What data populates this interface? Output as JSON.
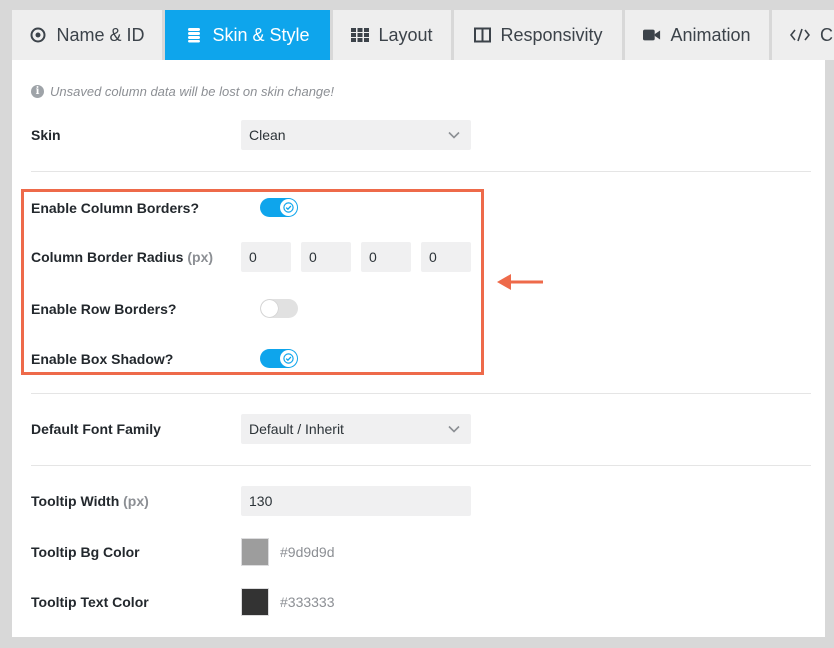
{
  "tabs": [
    {
      "label": "Name & ID",
      "icon": "target-icon",
      "active": false
    },
    {
      "label": "Skin & Style",
      "icon": "layers-icon",
      "active": true
    },
    {
      "label": "Layout",
      "icon": "grid-icon",
      "active": false
    },
    {
      "label": "Responsivity",
      "icon": "columns-icon",
      "active": false
    },
    {
      "label": "Animation",
      "icon": "video-camera-icon",
      "active": false
    },
    {
      "label": "</>",
      "icon": "code-icon",
      "active": false,
      "partial_text": "C"
    }
  ],
  "notice": {
    "text": "Unsaved column data will be lost on skin change!",
    "icon": "info-icon"
  },
  "skin": {
    "label": "Skin",
    "value": "Clean"
  },
  "column_borders": {
    "label": "Enable Column Borders?",
    "enabled": true
  },
  "border_radius": {
    "label": "Column Border Radius",
    "unit": "(px)",
    "values": [
      "0",
      "0",
      "0",
      "0"
    ]
  },
  "row_borders": {
    "label": "Enable Row Borders?",
    "enabled": false
  },
  "box_shadow": {
    "label": "Enable Box Shadow?",
    "enabled": true
  },
  "font_family": {
    "label": "Default Font Family",
    "value": "Default / Inherit"
  },
  "tooltip_width": {
    "label": "Tooltip Width",
    "unit": "(px)",
    "value": "130"
  },
  "tooltip_bg": {
    "label": "Tooltip Bg Color",
    "value": "#9d9d9d"
  },
  "tooltip_text": {
    "label": "Tooltip Text Color",
    "value": "#333333"
  },
  "colors": {
    "accent": "#0ea5ec",
    "highlight": "#ee6a4a"
  }
}
